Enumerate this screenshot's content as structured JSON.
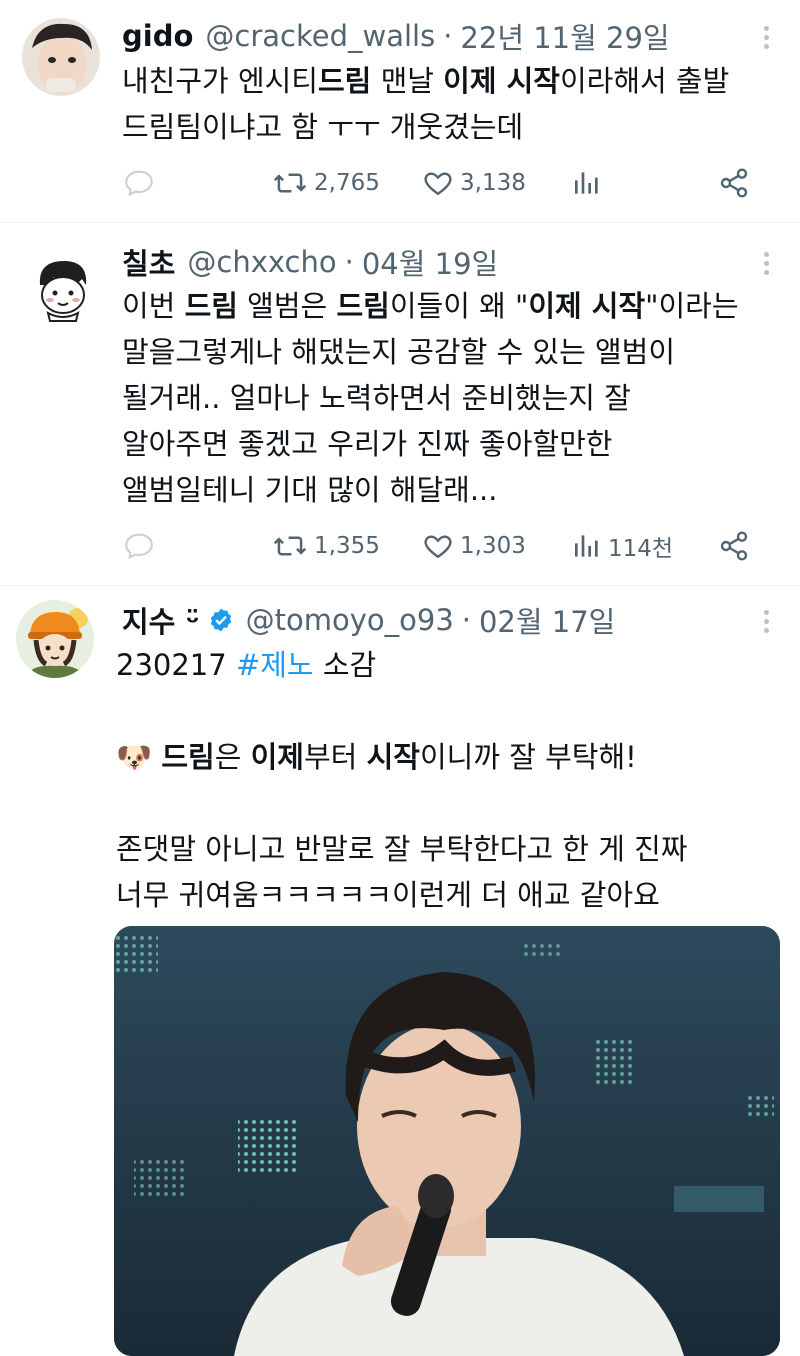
{
  "tweets": [
    {
      "name": "gido",
      "handle": "@cracked_walls",
      "sep": "·",
      "date": "22년 11월 29일",
      "text_segments": [
        {
          "t": "내친구가 엔시티"
        },
        {
          "t": "드림",
          "bold": true
        },
        {
          "t": " 맨날 "
        },
        {
          "t": "이제 시작",
          "bold": true
        },
        {
          "t": "이라해서 출발"
        },
        {
          "br": true
        },
        {
          "t": "드림팀이냐고 함 ㅜㅜ 개웃겼는데"
        }
      ],
      "stats": {
        "retweets": "2,765",
        "likes": "3,138",
        "views": ""
      }
    },
    {
      "name": "칠초",
      "handle": "@chxxcho",
      "sep": "·",
      "date": "04월 19일",
      "text_segments": [
        {
          "t": "이번 "
        },
        {
          "t": "드림",
          "bold": true
        },
        {
          "t": " 앨범은 "
        },
        {
          "t": "드림",
          "bold": true
        },
        {
          "t": "이들이 왜 \""
        },
        {
          "t": "이제 시작",
          "bold": true
        },
        {
          "t": "\"이라는"
        },
        {
          "br": true
        },
        {
          "t": "말을그렇게나 해댔는지 공감할 수 있는 앨범이"
        },
        {
          "br": true
        },
        {
          "t": "될거래.. 얼마나 노력하면서 준비했는지 잘"
        },
        {
          "br": true
        },
        {
          "t": "알아주면 좋겠고 우리가 진짜 좋아할만한"
        },
        {
          "br": true
        },
        {
          "t": "앨범일테니 기대 많이 해달래..."
        }
      ],
      "stats": {
        "retweets": "1,355",
        "likes": "1,303",
        "views": "114천"
      }
    },
    {
      "name": "지수 ᵕ̈",
      "handle": "@tomoyo_o93",
      "sep": "·",
      "date": "02월 17일",
      "verified": true,
      "text_segments": [
        {
          "t": "230217 "
        },
        {
          "t": "#제노",
          "tag": true
        },
        {
          "t": " 소감"
        },
        {
          "br": true
        },
        {
          "br": true
        },
        {
          "t": "🐶 "
        },
        {
          "t": "드림",
          "bold": true
        },
        {
          "t": "은 "
        },
        {
          "t": "이제",
          "bold": true
        },
        {
          "t": "부터 "
        },
        {
          "t": "시작",
          "bold": true
        },
        {
          "t": "이니까 잘 부탁해!"
        },
        {
          "br": true
        },
        {
          "br": true
        },
        {
          "t": "존댓말 아니고 반말로 잘 부탁한다고 한 게 진짜"
        },
        {
          "br": true
        },
        {
          "t": "너무 귀여움ㅋㅋㅋㅋㅋ이런게 더 애교 같아요"
        }
      ]
    }
  ],
  "colors": {
    "accent": "#1d9bf0",
    "secondary_text": "#536471",
    "primary_text": "#0f1419"
  },
  "icons": {
    "reply": "reply-icon",
    "retweet": "retweet-icon",
    "like": "heart-icon",
    "views": "views-icon",
    "share": "share-icon",
    "more": "more-icon",
    "verified": "verified-badge-icon"
  }
}
